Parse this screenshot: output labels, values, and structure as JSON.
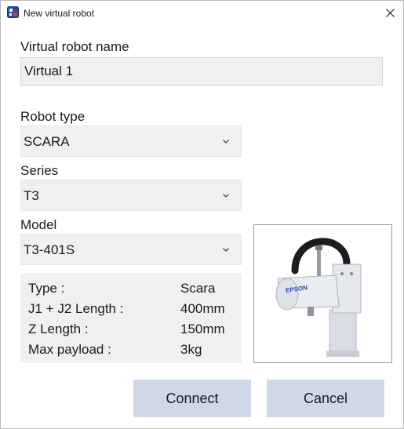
{
  "window": {
    "title": "New virtual robot",
    "app_icon": "robot-app-icon",
    "close_icon": "close-icon"
  },
  "form": {
    "name_label": "Virtual robot name",
    "name_value": "Virtual 1",
    "robot_type_label": "Robot type",
    "robot_type_value": "SCARA",
    "series_label": "Series",
    "series_value": "T3",
    "model_label": "Model",
    "model_value": "T3-401S",
    "dropdown_icon": "chevron-down-icon"
  },
  "specs": [
    {
      "label": "Type :",
      "value": "Scara"
    },
    {
      "label": "J1 + J2 Length :",
      "value": "400mm"
    },
    {
      "label": "Z Length :",
      "value": "150mm"
    },
    {
      "label": "Max payload :",
      "value": "3kg"
    }
  ],
  "robot_image": {
    "logo_text": "EPSON"
  },
  "buttons": {
    "connect": "Connect",
    "cancel": "Cancel"
  }
}
